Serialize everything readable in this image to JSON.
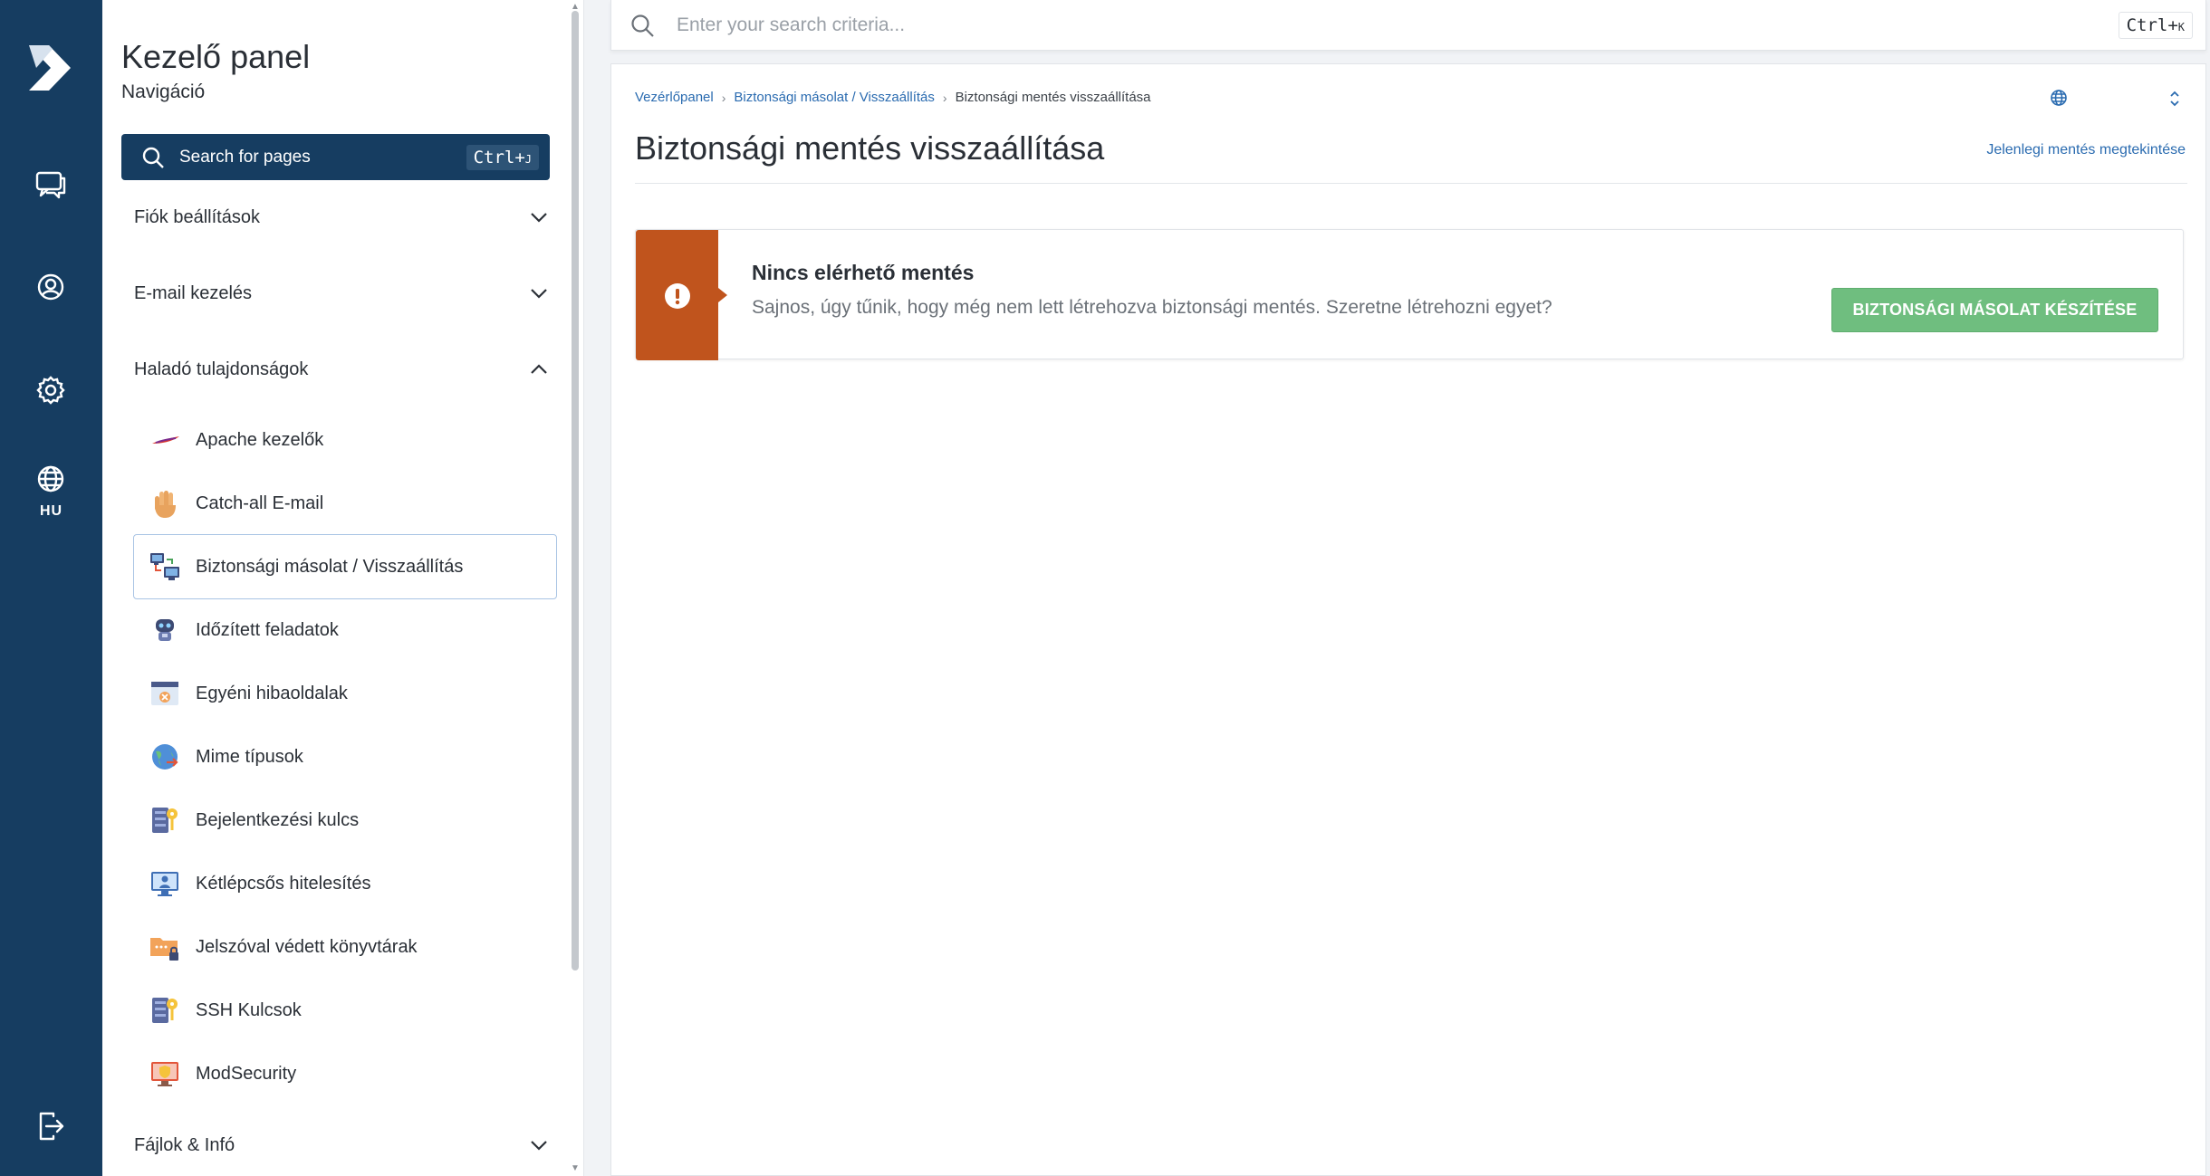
{
  "rail": {
    "lang": "HU"
  },
  "nav": {
    "title": "Kezelő panel",
    "subtitle": "Navigáció",
    "search_label": "Search for pages",
    "search_shortcut": "Ctrl+",
    "search_shortcut_key": "J",
    "sections": [
      {
        "label": "Fiók beállítások",
        "expanded": false
      },
      {
        "label": "E-mail kezelés",
        "expanded": false
      },
      {
        "label": "Haladó tulajdonságok",
        "expanded": true
      },
      {
        "label": "Fájlok & Infó",
        "expanded": false
      }
    ],
    "items": [
      {
        "label": "Apache kezelők",
        "icon": "apache-feather-icon"
      },
      {
        "label": "Catch-all E-mail",
        "icon": "hand-icon"
      },
      {
        "label": "Biztonsági másolat / Visszaállítás",
        "icon": "backup-computers-icon",
        "active": true
      },
      {
        "label": "Időzített feladatok",
        "icon": "robot-icon"
      },
      {
        "label": "Egyéni hibaoldalak",
        "icon": "error-page-icon"
      },
      {
        "label": "Mime típusok",
        "icon": "globe-arrows-icon"
      },
      {
        "label": "Bejelentkezési kulcs",
        "icon": "server-key-icon"
      },
      {
        "label": "Kétlépcsős hitelesítés",
        "icon": "monitor-user-icon"
      },
      {
        "label": "Jelszóval védett könyvtárak",
        "icon": "folder-lock-icon"
      },
      {
        "label": "SSH Kulcsok",
        "icon": "server-key-icon"
      },
      {
        "label": "ModSecurity",
        "icon": "shield-monitor-icon"
      }
    ]
  },
  "topbar": {
    "search_placeholder": "Enter your search criteria...",
    "shortcut": "Ctrl+",
    "shortcut_key": "K"
  },
  "breadcrumb": {
    "items": [
      "Vezérlőpanel",
      "Biztonsági másolat / Visszaállítás"
    ],
    "current": "Biztonsági mentés visszaállítása"
  },
  "page": {
    "title": "Biztonsági mentés visszaállítása",
    "view_link": "Jelenlegi mentés megtekintése"
  },
  "alert": {
    "title": "Nincs elérhető mentés",
    "text": "Sajnos, úgy tűnik, hogy még nem lett létrehozva biztonsági mentés. Szeretne létrehozni egyet?",
    "button": "BIZTONSÁGI MÁSOLAT KÉSZÍTÉSE",
    "color": "#c0541d",
    "button_color": "#6fbe7f"
  },
  "colors": {
    "brand": "#163d61",
    "link": "#2a6bb0"
  }
}
